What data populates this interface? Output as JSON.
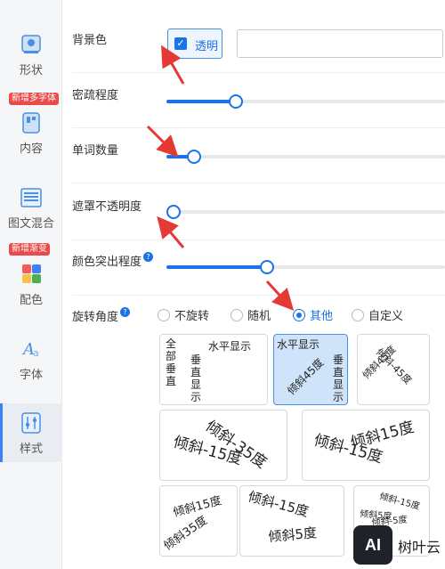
{
  "sidebar": {
    "items": [
      {
        "label": "形状",
        "icon": "shape-icon"
      },
      {
        "label": "内容",
        "icon": "content-icon",
        "badge": "新增多字体"
      },
      {
        "label": "图文混合",
        "icon": "image-text-icon"
      },
      {
        "label": "配色",
        "icon": "palette-icon",
        "badge": "新增渐变"
      },
      {
        "label": "字体",
        "icon": "font-icon"
      },
      {
        "label": "样式",
        "icon": "style-icon",
        "active": true
      }
    ]
  },
  "settings": {
    "background": {
      "label": "背景色",
      "transparent_label": "透明",
      "transparent_checked": true,
      "color_value": ""
    },
    "density": {
      "label": "密疏程度",
      "value": 0.25
    },
    "word_count": {
      "label": "单词数量",
      "value": 0.1
    },
    "mask_opacity": {
      "label": "遮罩不透明度",
      "value": 0.0
    },
    "color_emphasis": {
      "label": "颜色突出程度",
      "value": 0.36
    },
    "rotation": {
      "label": "旋转角度",
      "options": [
        "不旋转",
        "随机",
        "其他",
        "自定义"
      ],
      "selected": "其他"
    }
  },
  "rotation_presets": [
    {
      "id": "vertical-mixed",
      "words": [
        "全部垂直",
        "垂直显示",
        "水平显示"
      ]
    },
    {
      "id": "horizontal-vertical-45",
      "words": [
        "水平显示",
        "倾斜45度",
        "垂直显示"
      ],
      "selected": true
    },
    {
      "id": "tilt-45-minus-45",
      "words": [
        "倾斜45度",
        "倾斜-45度"
      ]
    },
    {
      "id": "tilt-minus35-minus15",
      "words": [
        "倾斜-35度",
        "倾斜-15度"
      ]
    },
    {
      "id": "tilt-15-minus15",
      "words": [
        "倾斜15度",
        "倾斜-15度"
      ]
    },
    {
      "id": "tilt-15-35",
      "words": [
        "倾斜15度",
        "倾斜35度"
      ]
    },
    {
      "id": "tilt-minus15-5",
      "words": [
        "倾斜-15度",
        "倾斜5度"
      ]
    },
    {
      "id": "tilt-mixed-small",
      "words": [
        "倾斜-15度",
        "倾斜5度",
        "倾斜-5度"
      ]
    }
  ],
  "watermark": {
    "logo": "AI",
    "text": "树叶云"
  },
  "colors": {
    "accent": "#1a73e8",
    "annotation": "#e53935",
    "badge": "#e94b4b"
  }
}
